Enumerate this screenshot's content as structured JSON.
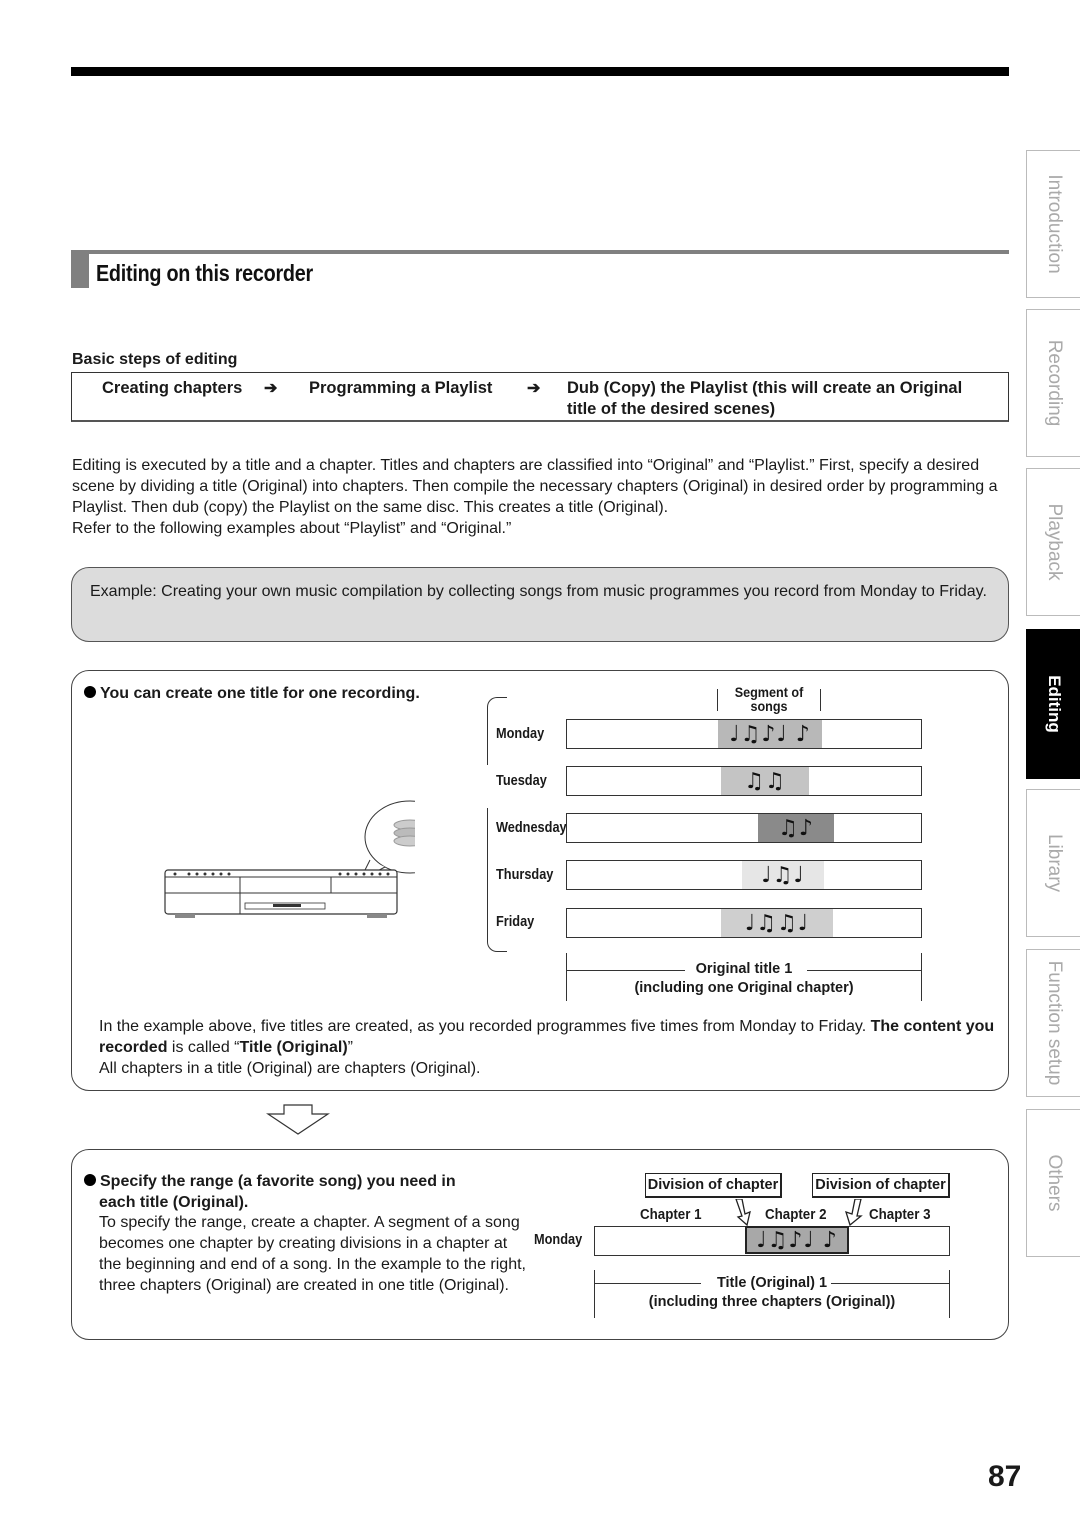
{
  "section": {
    "title": "Editing on this recorder"
  },
  "basic_steps": {
    "label": "Basic steps of editing",
    "steps": [
      "Creating chapters",
      "Programming a Playlist",
      "Dub (Copy) the Playlist (this will create an Original",
      "title of the desired scenes)"
    ],
    "arrow": "➔"
  },
  "intro": {
    "paragraph": "Editing is executed by a title and a chapter. Titles and chapters are classified into “Original” and “Playlist.” First, specify a desired scene by dividing a title (Original) into chapters. Then compile the necessary chapters (Original) in desired order by programming a Playlist. Then dub (copy) the Playlist on the same disc. This creates a title (Original).",
    "paragraph2": "Refer to the following examples about “Playlist” and “Original.”"
  },
  "example": {
    "text": "Example: Creating your own music compilation by collecting songs from music programmes you record from Monday to Friday."
  },
  "box1": {
    "heading": "You can create one title for one recording.",
    "segment_label_1": "Segment of",
    "segment_label_2": "songs",
    "days": [
      {
        "name": "Monday",
        "notes": "♩♫♪♩ ♪",
        "shade": "#b8b8b8"
      },
      {
        "name": "Tuesday",
        "notes": "♫♫",
        "shade": "#c4c4c4"
      },
      {
        "name": "Wednesday",
        "notes": "♫♪",
        "shade": "#8a8a8a"
      },
      {
        "name": "Thursday",
        "notes": "♩♫♩",
        "shade": "#e6e6e6"
      },
      {
        "name": "Friday",
        "notes": "♩♫♫♩",
        "shade": "#cfcfcf"
      }
    ],
    "title_label_1": "Original title 1",
    "title_label_2": "(including one Original chapter)",
    "text_1": "In the example above, five titles are created, as you recorded programmes five times from Monday to Friday. ",
    "text_bold_1": "The content you recorded",
    "text_2": " is called “",
    "text_bold_2": "Title (Original)",
    "text_3": "”",
    "text_4": "All chapters in a title (Original) are chapters (Original)."
  },
  "box2": {
    "heading_1": "Specify the range (a favorite song) you need in",
    "heading_2": "each title (Original).",
    "text": "To specify the range, create a chapter. A segment of a song becomes one chapter by creating divisions in a chapter at the beginning and end of a song. In the example to the right, three chapters (Original) are created in one title (Original).",
    "division_label": "Division of chapter",
    "chapters": [
      "Chapter 1",
      "Chapter 2",
      "Chapter 3"
    ],
    "day": "Monday",
    "notes": "♩♫♪♩ ♪",
    "title_label_1": "Title (Original) 1",
    "title_label_2": "(including three chapters (Original))"
  },
  "side_tabs": [
    {
      "label": "Introduction",
      "active": false
    },
    {
      "label": "Recording",
      "active": false
    },
    {
      "label": "Playback",
      "active": false
    },
    {
      "label": "Editing",
      "active": true
    },
    {
      "label": "Library",
      "active": false
    },
    {
      "label": "Function setup",
      "active": false
    },
    {
      "label": "Others",
      "active": false
    }
  ],
  "page_number": "87"
}
